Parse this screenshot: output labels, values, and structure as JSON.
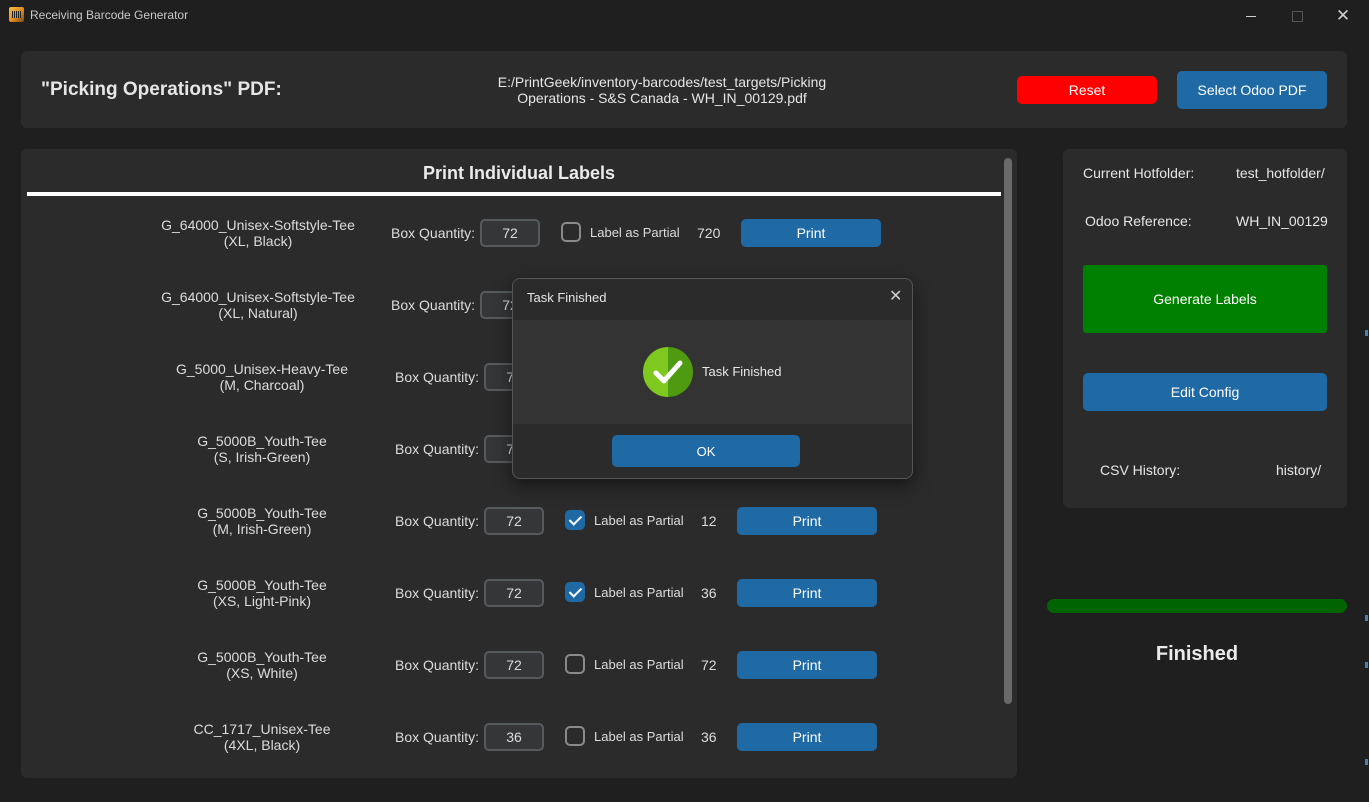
{
  "window": {
    "title": "Receiving Barcode Generator",
    "controls": {
      "minimize": "minimize",
      "maximize": "maximize",
      "close": "✕"
    }
  },
  "header": {
    "pdf_label": "\"Picking Operations\" PDF:",
    "pdf_path": "E:/PrintGeek/inventory-barcodes/test_targets/Picking Operations - S&S Canada - WH_IN_00129.pdf",
    "reset_label": "Reset",
    "select_pdf_label": "Select Odoo PDF",
    "reset_color": "#ff0000"
  },
  "labels_panel": {
    "title": "Print Individual Labels",
    "box_quantity_label": "Box Quantity:",
    "partial_label": "Label as Partial",
    "print_label": "Print",
    "items": [
      {
        "name": "G_64000_Unisex-Softstyle-Tee",
        "variant": "(XL, Black)",
        "box_quantity": "72",
        "partial": false,
        "count": "720"
      },
      {
        "name": "G_64000_Unisex-Softstyle-Tee",
        "variant": "(XL, Natural)",
        "box_quantity": "72",
        "partial": false,
        "count": ""
      },
      {
        "name": "G_5000_Unisex-Heavy-Tee",
        "variant": "(M, Charcoal)",
        "box_quantity": "72",
        "partial": false,
        "count": ""
      },
      {
        "name": "G_5000B_Youth-Tee",
        "variant": "(S, Irish-Green)",
        "box_quantity": "72",
        "partial": false,
        "count": ""
      },
      {
        "name": "G_5000B_Youth-Tee",
        "variant": "(M, Irish-Green)",
        "box_quantity": "72",
        "partial": true,
        "count": "12"
      },
      {
        "name": "G_5000B_Youth-Tee",
        "variant": "(XS, Light-Pink)",
        "box_quantity": "72",
        "partial": true,
        "count": "36"
      },
      {
        "name": "G_5000B_Youth-Tee",
        "variant": "(XS, White)",
        "box_quantity": "72",
        "partial": false,
        "count": "72"
      },
      {
        "name": "CC_1717_Unisex-Tee",
        "variant": "(4XL, Black)",
        "box_quantity": "36",
        "partial": false,
        "count": "36"
      }
    ]
  },
  "side_panel": {
    "hotfolder_label": "Current Hotfolder:",
    "hotfolder_value": "test_hotfolder/",
    "odoo_ref_label": "Odoo Reference:",
    "odoo_ref_value": "WH_IN_00129",
    "generate_label": "Generate Labels",
    "generate_color": "#008000",
    "edit_config_label": "Edit Config",
    "csv_history_label": "CSV History:",
    "csv_history_value": "history/",
    "progress": 1.0,
    "status": "Finished"
  },
  "dialog": {
    "title": "Task Finished",
    "message": "Task Finished",
    "close_glyph": "✕",
    "ok_label": "OK",
    "icon": "check-circle-icon"
  },
  "colors": {
    "accent_blue": "#1f6aa5",
    "panel": "#2b2b2b",
    "background": "#1f1f1f",
    "progress": "#006400"
  }
}
